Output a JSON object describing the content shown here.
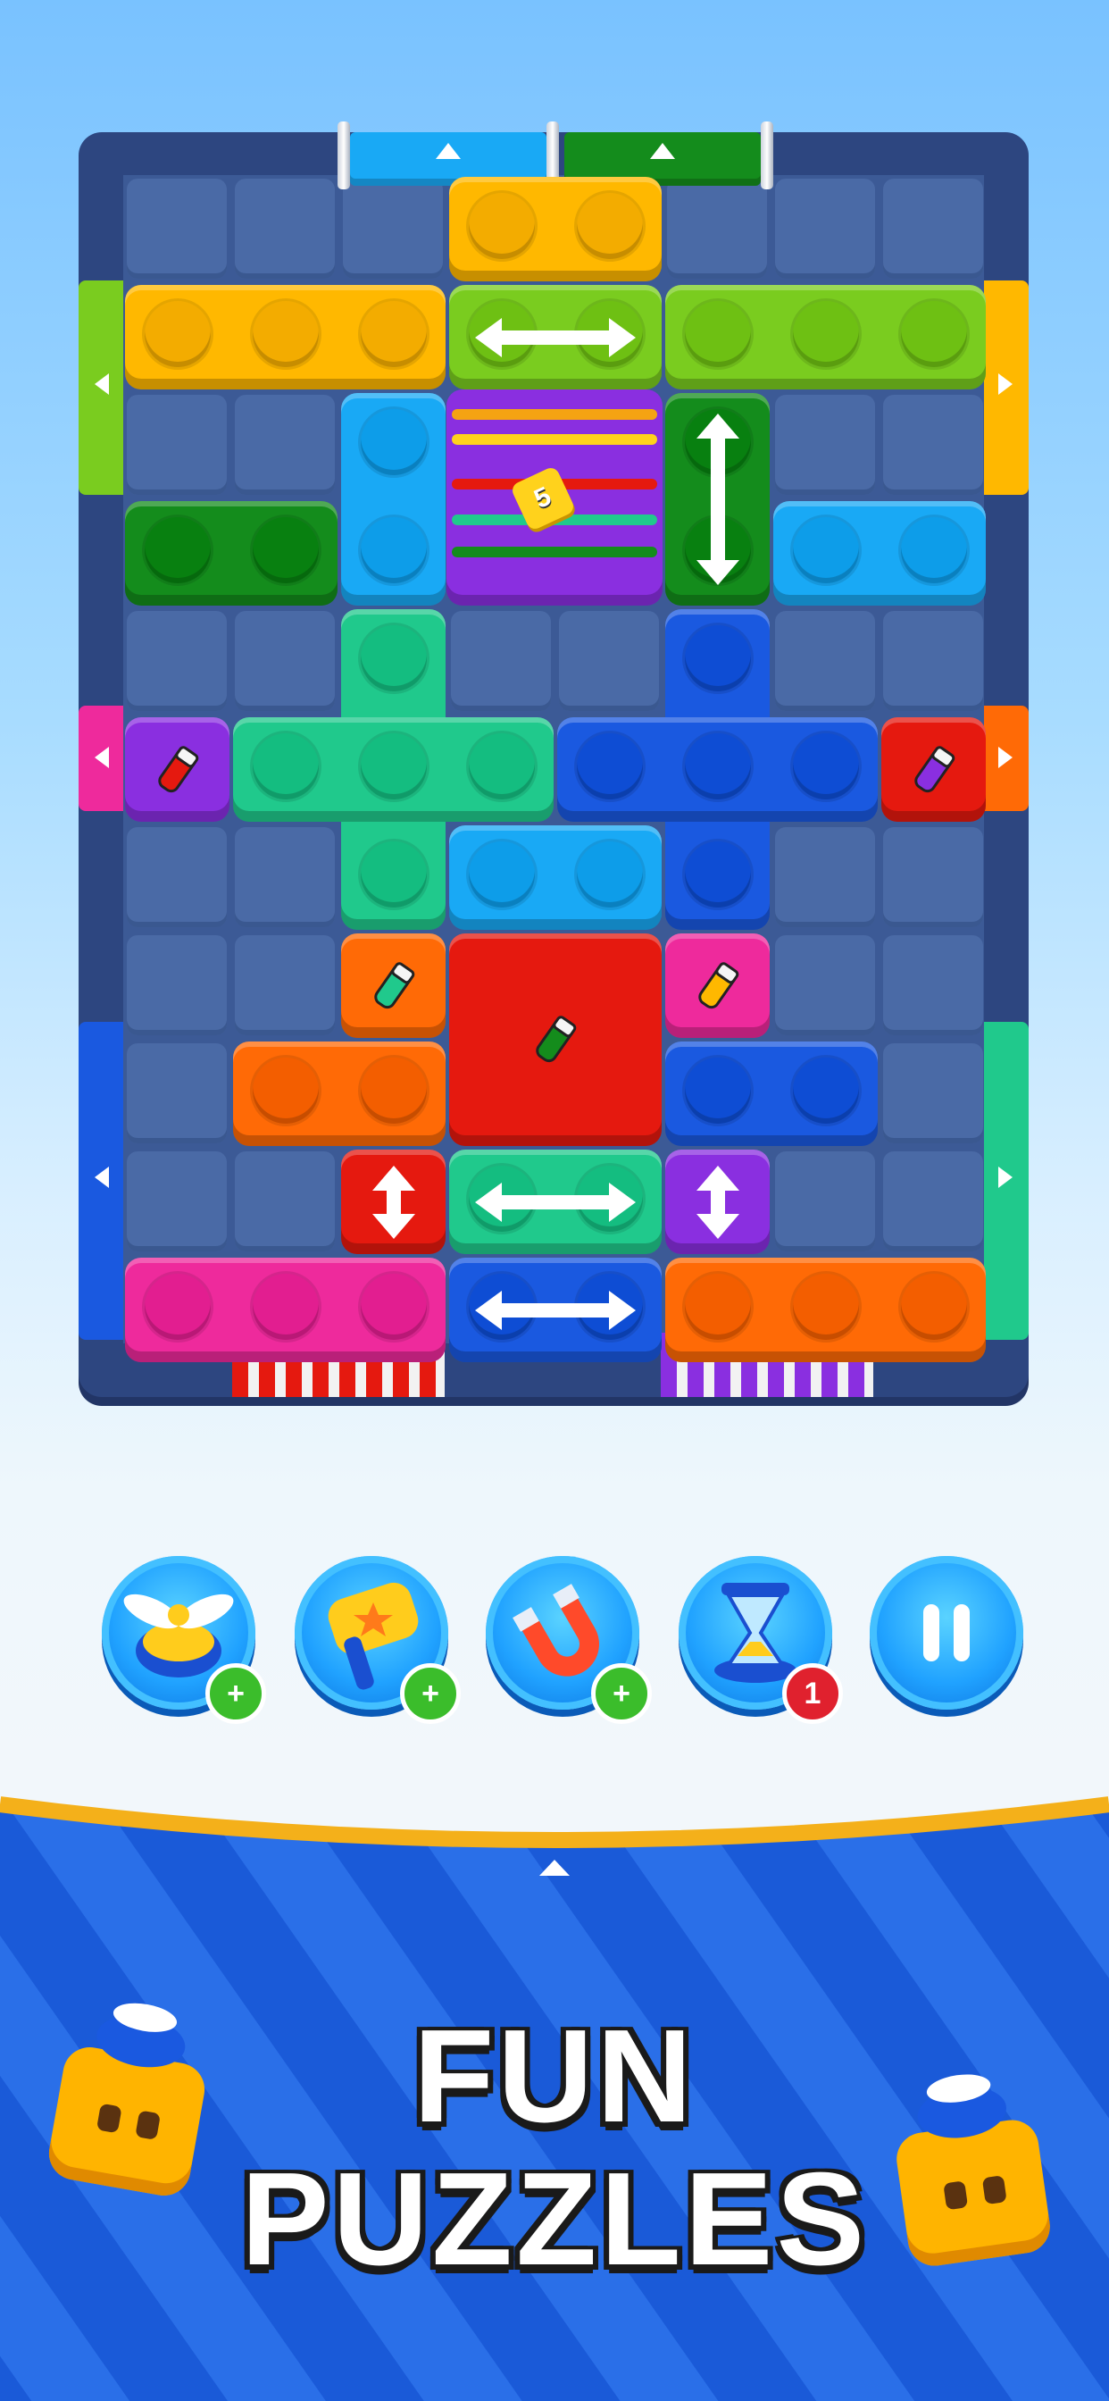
{
  "level_tag": "5",
  "colors": {
    "yellow": "#ffb800",
    "lime": "#7acc1f",
    "green": "#148c1c",
    "cyan": "#19a9f5",
    "purple": "#8a2fe0",
    "mint": "#20c98c",
    "blue": "#1a59e0",
    "red": "#e5190f",
    "orange": "#ff6a06",
    "pink": "#ee2a9c"
  },
  "boosters": [
    {
      "name": "propeller",
      "badge": "+",
      "badge_color": "#3bbd2b"
    },
    {
      "name": "hammer",
      "badge": "+",
      "badge_color": "#3bbd2b"
    },
    {
      "name": "magnet",
      "badge": "+",
      "badge_color": "#3bbd2b"
    },
    {
      "name": "hourglass",
      "badge": "1",
      "badge_color": "#e0212e"
    },
    {
      "name": "pause",
      "badge": "",
      "badge_color": ""
    }
  ],
  "title": {
    "line1": "FUN",
    "line2": "PUZZLES"
  }
}
